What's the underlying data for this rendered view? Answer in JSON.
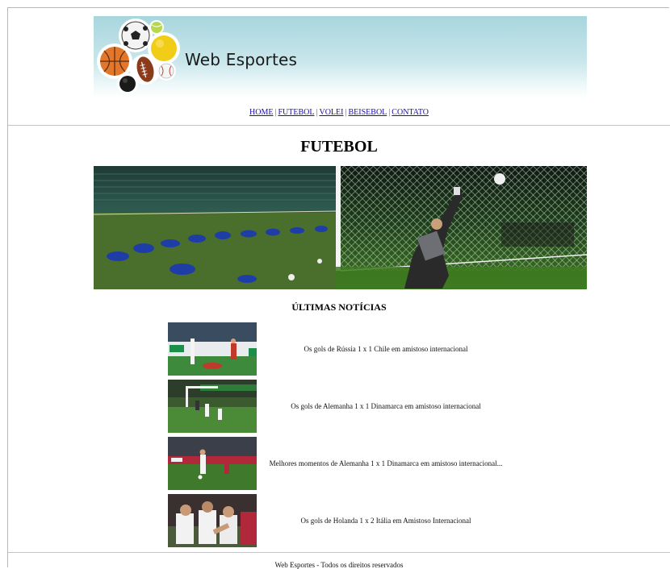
{
  "header": {
    "site_title": "Web Esportes",
    "logo_icon": "sports-balls-logo"
  },
  "nav": {
    "items": [
      {
        "label": "HOME"
      },
      {
        "label": "FUTEBOL"
      },
      {
        "label": "VOLEI"
      },
      {
        "label": "BEISEBOL"
      },
      {
        "label": "CONTATO"
      }
    ],
    "separator": "|"
  },
  "main": {
    "page_heading": "FUTEBOL",
    "news_section_title": "ÚLTIMAS NOTÍCIAS",
    "news": [
      {
        "title": "Os gols de Rússia 1 x 1 Chile em amistoso internacional"
      },
      {
        "title": "Os gols de Alemanha 1 x 1 Dinamarca em amistoso internacional"
      },
      {
        "title": "Melhores momentos de Alemanha 1 x 1 Dinamarca em amistoso internacional..."
      },
      {
        "title": "Os gols de Holanda 1 x 2 Itália em Amistoso Internacional"
      }
    ]
  },
  "footer": {
    "text": "Web Esportes - Todos os direitos reservados"
  },
  "colors": {
    "banner_top": "#a8d6dd",
    "link": "#1a0dab",
    "divider": "#c4c4c4"
  }
}
